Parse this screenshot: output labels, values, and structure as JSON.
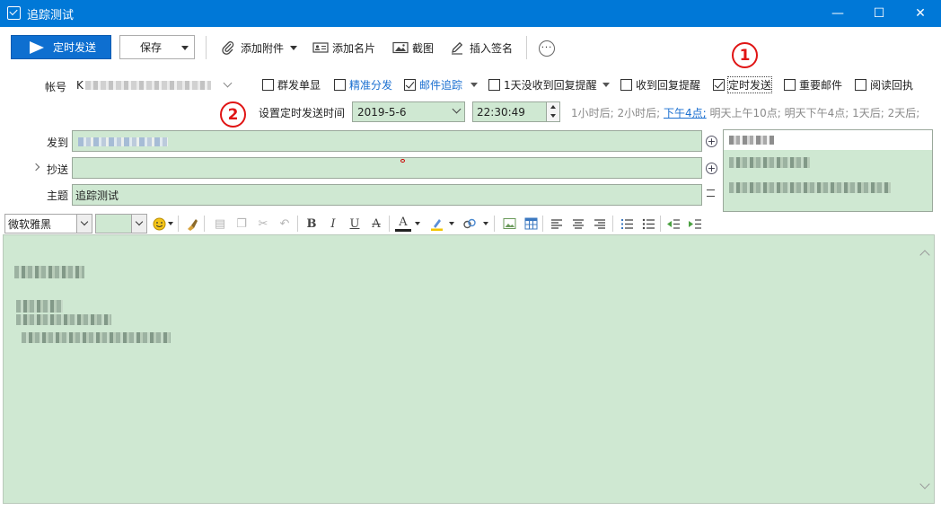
{
  "window": {
    "title": "追踪测试",
    "minimize": "—",
    "maximize": "☐",
    "close": "✕"
  },
  "toolbar": {
    "send_label": "定时发送",
    "save_label": "保存",
    "attach_label": "添加附件",
    "card_label": "添加名片",
    "screenshot_label": "截图",
    "signature_label": "插入签名",
    "more_label": "···"
  },
  "account": {
    "label": "帐号",
    "value_prefix": "K"
  },
  "options": [
    {
      "label": "群发单显",
      "checked": false
    },
    {
      "label": "精准分发",
      "checked": false
    },
    {
      "label": "邮件追踪",
      "checked": true
    },
    {
      "label": "1天没收到回复提醒",
      "checked": false
    },
    {
      "label": "收到回复提醒",
      "checked": false
    },
    {
      "label": "定时发送",
      "checked": true
    },
    {
      "label": "重要邮件",
      "checked": false
    },
    {
      "label": "阅读回执",
      "checked": false
    }
  ],
  "annotations": {
    "one": "1",
    "two": "2"
  },
  "schedule": {
    "label": "设置定时发送时间",
    "date": "2019-5-6",
    "time": "22:30:49",
    "quick_before": "1小时后; 2小时后;",
    "quick_link": "下午4点;",
    "quick_after": "明天上午10点; 明天下午4点; 1天后; 2天后;"
  },
  "fields": {
    "to_label": "发到",
    "cc_label": "抄送",
    "subject_label": "主题",
    "subject_value": "追踪测试"
  },
  "format": {
    "font_name": "微软雅黑"
  },
  "colors": {
    "titlebar": "#0078d7",
    "send_button": "#0e6fd0",
    "field_bg": "#cfe8d2",
    "annotation": "#e01414",
    "link": "#1a6fd0"
  }
}
